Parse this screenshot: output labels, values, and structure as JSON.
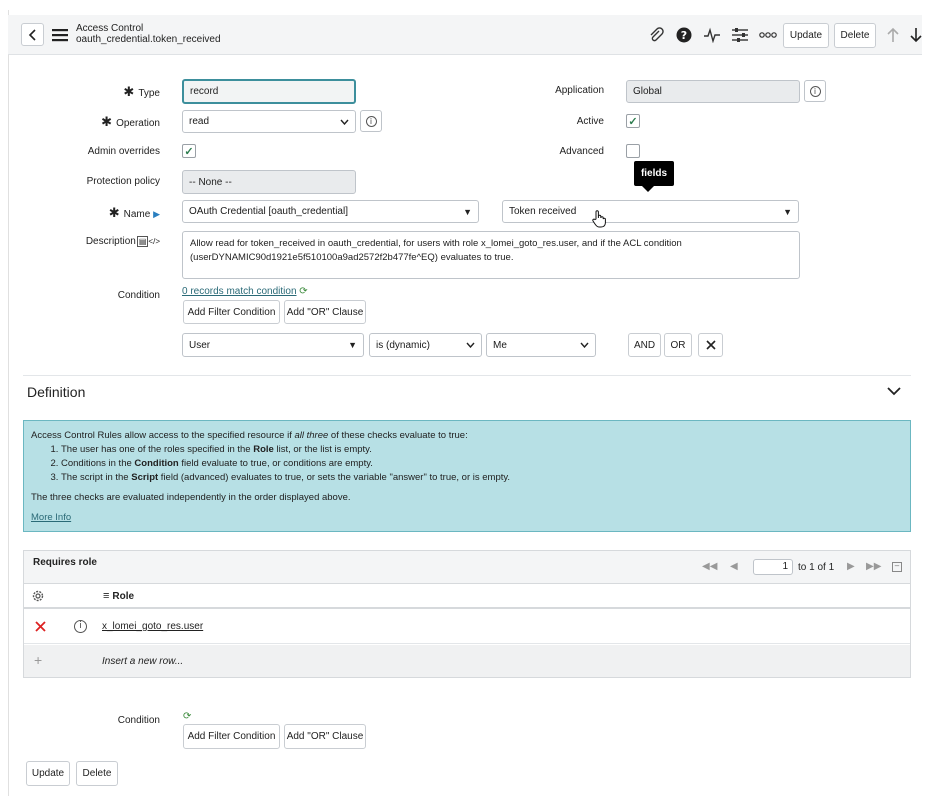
{
  "header": {
    "title": "Access Control",
    "subtitle": "oauth_credential.token_received",
    "update_label": "Update",
    "delete_label": "Delete"
  },
  "form": {
    "type": {
      "label": "Type",
      "value": "record"
    },
    "application": {
      "label": "Application",
      "value": "Global"
    },
    "operation": {
      "label": "Operation",
      "value": "read"
    },
    "active": {
      "label": "Active",
      "checked": true
    },
    "admin_overrides": {
      "label": "Admin overrides",
      "checked": true
    },
    "advanced": {
      "label": "Advanced",
      "checked": false
    },
    "protection_policy": {
      "label": "Protection policy",
      "value": "-- None --"
    },
    "name": {
      "label": "Name",
      "table_value": "OAuth Credential [oauth_credential]",
      "field_value": "Token received"
    },
    "tooltip": "fields",
    "description": {
      "label": "Description",
      "value": "Allow read for token_received in oauth_credential, for users with role x_lomei_goto_res.user, and if the ACL condition (userDYNAMIC90d1921e5f510100a9ad2572f2b477fe^EQ) evaluates to true."
    },
    "condition": {
      "label": "Condition",
      "match_text": "0 records match condition",
      "add_filter_label": "Add Filter Condition",
      "add_or_label": "Add \"OR\" Clause",
      "field": "User",
      "operator": "is (dynamic)",
      "value": "Me",
      "and_label": "AND",
      "or_label": "OR"
    }
  },
  "definition": {
    "title": "Definition",
    "intro_prefix": "Access Control Rules allow access to the specified resource if ",
    "intro_em": "all three",
    "intro_suffix": " of these checks evaluate to true:",
    "item1_a": "The user has one of the roles specified in the ",
    "item1_b": "Role",
    "item1_c": " list, or the list is empty.",
    "item2_a": "Conditions in the ",
    "item2_b": "Condition",
    "item2_c": " field evaluate to true, or conditions are empty.",
    "item3_a": "The script in the ",
    "item3_b": "Script",
    "item3_c": " field (advanced) evaluates to true, or sets the variable \"answer\" to true, or is empty.",
    "footer": "The three checks are evaluated independently in the order displayed above.",
    "more_info": "More Info"
  },
  "requires_role": {
    "title": "Requires role",
    "page_value": "1",
    "page_of": "to 1 of 1",
    "column": "Role",
    "rows": [
      {
        "role": "x_lomei_goto_res.user"
      }
    ],
    "insert_label": "Insert a new row..."
  },
  "bottom": {
    "condition_label": "Condition",
    "add_filter_label": "Add Filter Condition",
    "add_or_label": "Add \"OR\" Clause",
    "update_label": "Update",
    "delete_label": "Delete"
  }
}
